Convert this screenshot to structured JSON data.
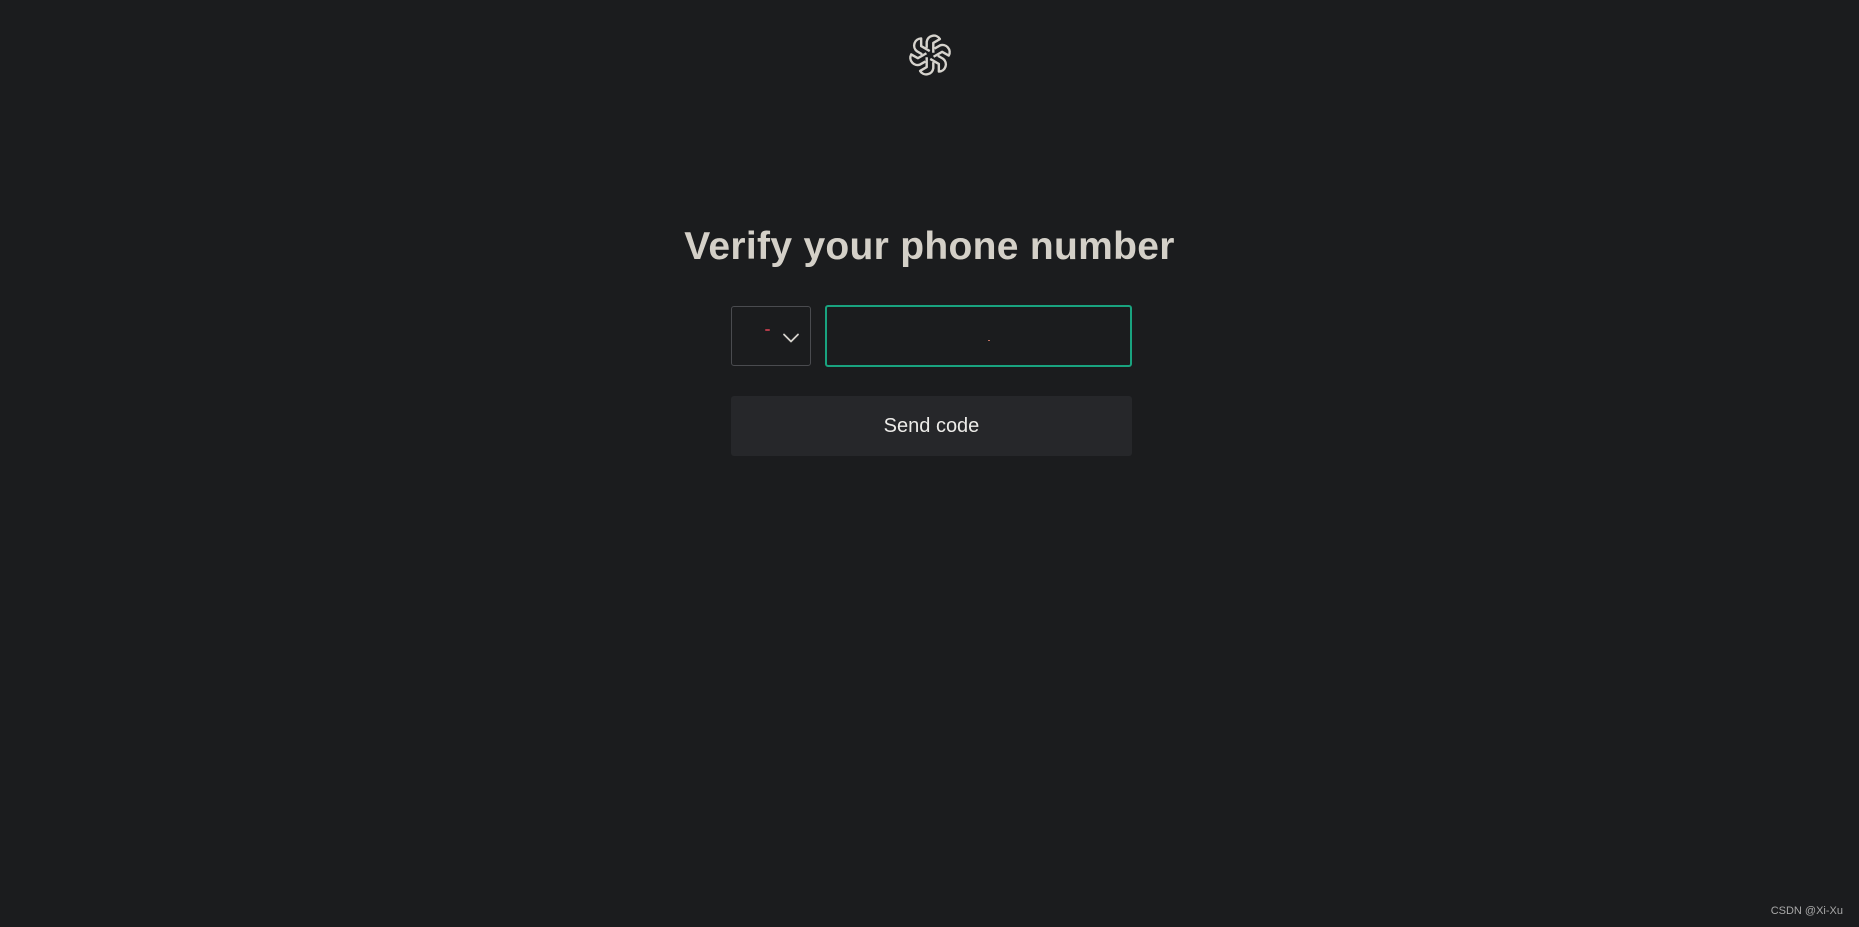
{
  "header": {
    "logo_icon": "openai-logo-icon"
  },
  "main": {
    "title": "Verify your phone number",
    "country_select": {
      "chevron_icon": "chevron-down-icon"
    },
    "phone_input": {
      "value": "",
      "placeholder": ""
    },
    "send_button_label": "Send code"
  },
  "watermark": "CSDN @Xi-Xu",
  "colors": {
    "background": "#1b1c1e",
    "accent": "#19a37f",
    "button_bg": "#26272a",
    "title_text": "#d4d0c8"
  }
}
